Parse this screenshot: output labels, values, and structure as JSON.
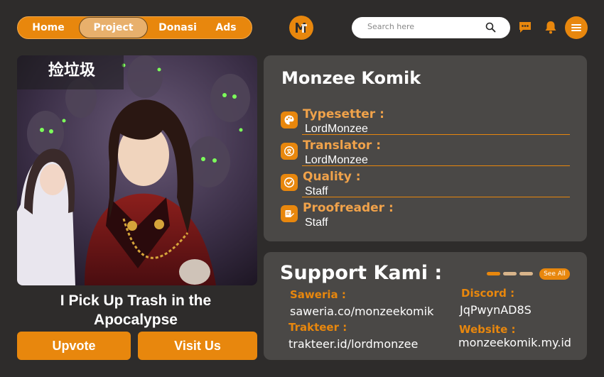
{
  "nav": {
    "items": [
      {
        "label": "Home"
      },
      {
        "label": "Project"
      },
      {
        "label": "Donasi"
      },
      {
        "label": "Ads"
      }
    ],
    "active": "Project"
  },
  "search": {
    "placeholder": "Search here"
  },
  "icons": {
    "logo": "monzee-logo-icon",
    "search": "search-icon",
    "chat": "chat-icon",
    "bell": "bell-icon",
    "menu": "menu-icon"
  },
  "comic": {
    "title": "I Pick Up Trash in the Apocalypse",
    "upvote_label": "Upvote",
    "visit_label": "Visit Us"
  },
  "team": {
    "name": "Monzee Komik",
    "roles": [
      {
        "label": "Typesetter :",
        "name": "LordMonzee",
        "icon": "palette-icon"
      },
      {
        "label": "Translator :",
        "name": "LordMonzee",
        "icon": "translate-icon"
      },
      {
        "label": "Quality :",
        "name": "Staff",
        "icon": "check-circle-icon"
      },
      {
        "label": "Proofreader :",
        "name": "Staff",
        "icon": "proofread-icon"
      }
    ]
  },
  "support": {
    "title": "Support Kami :",
    "see_all": "See All",
    "saweria_label": "Saweria :",
    "saweria_value": "saweria.co/monzeekomik",
    "trakteer_label": "Trakteer :",
    "trakteer_value": "trakteer.id/lordmonzee",
    "discord_label": "Discord :",
    "discord_value": "JqPwynAD8S",
    "website_label": "Website :",
    "website_value": "monzeekomik.my.id"
  },
  "colors": {
    "accent": "#e8870d",
    "background": "#2e2c2b",
    "panel": "#4a4846",
    "label": "#f0a24a"
  }
}
